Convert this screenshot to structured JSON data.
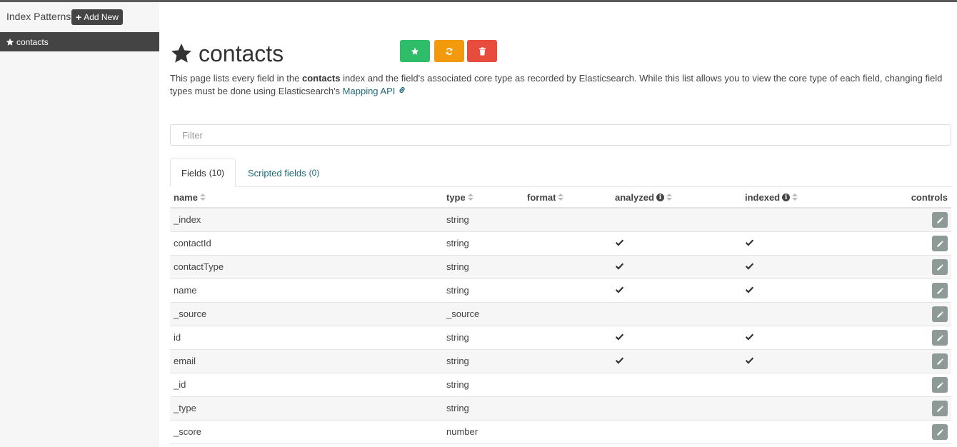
{
  "sidebar": {
    "title": "Index Patterns",
    "add_new_label": "Add New",
    "items": [
      {
        "label": "contacts",
        "starred": true
      }
    ]
  },
  "page": {
    "title": "contacts",
    "description": {
      "part1": "This page lists every field in the ",
      "index_name": "contacts",
      "part2": " index and the field's associated core type as recorded by Elasticsearch. While this list allows you to view the core type of each field, changing field types must be done using Elasticsearch's ",
      "link_text": "Mapping API"
    },
    "actions": [
      {
        "name": "set-default",
        "icon": "star-icon",
        "color": "#2fbd69"
      },
      {
        "name": "refresh",
        "icon": "refresh-icon",
        "color": "#f29a0c"
      },
      {
        "name": "delete",
        "icon": "trash-icon",
        "color": "#e74c3c"
      }
    ]
  },
  "filter": {
    "placeholder": "Filter",
    "value": ""
  },
  "tabs": [
    {
      "label": "Fields",
      "count": "(10)",
      "active": true
    },
    {
      "label": "Scripted fields",
      "count": "(0)",
      "active": false
    }
  ],
  "table": {
    "columns": {
      "name": "name",
      "type": "type",
      "format": "format",
      "analyzed": "analyzed",
      "indexed": "indexed",
      "controls": "controls"
    },
    "rows": [
      {
        "name": "_index",
        "type": "string",
        "analyzed": false,
        "indexed": false
      },
      {
        "name": "contactId",
        "type": "string",
        "analyzed": true,
        "indexed": true
      },
      {
        "name": "contactType",
        "type": "string",
        "analyzed": true,
        "indexed": true
      },
      {
        "name": "name",
        "type": "string",
        "analyzed": true,
        "indexed": true
      },
      {
        "name": "_source",
        "type": "_source",
        "analyzed": false,
        "indexed": false
      },
      {
        "name": "id",
        "type": "string",
        "analyzed": true,
        "indexed": true
      },
      {
        "name": "email",
        "type": "string",
        "analyzed": true,
        "indexed": true
      },
      {
        "name": "_id",
        "type": "string",
        "analyzed": false,
        "indexed": false
      },
      {
        "name": "_type",
        "type": "string",
        "analyzed": false,
        "indexed": false
      },
      {
        "name": "_score",
        "type": "number",
        "analyzed": false,
        "indexed": false
      }
    ]
  },
  "colors": {
    "dark": "#444444",
    "link": "#1f6b7a",
    "row_alt": "#f6f6f6",
    "edit_button": "#8e9a98"
  }
}
